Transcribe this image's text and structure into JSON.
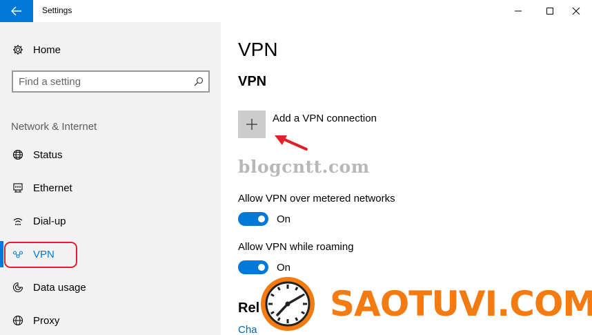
{
  "window": {
    "title": "Settings",
    "back_icon": "arrow-left-icon",
    "accent": "#0078d7"
  },
  "sidebar": {
    "home_label": "Home",
    "search_placeholder": "Find a setting",
    "section_label": "Network & Internet",
    "items": [
      {
        "label": "Status",
        "icon": "globe-icon"
      },
      {
        "label": "Ethernet",
        "icon": "ethernet-icon"
      },
      {
        "label": "Dial-up",
        "icon": "dialup-icon"
      },
      {
        "label": "VPN",
        "icon": "vpn-icon"
      },
      {
        "label": "Data usage",
        "icon": "data-usage-icon"
      },
      {
        "label": "Proxy",
        "icon": "proxy-icon"
      }
    ],
    "active_item": "VPN"
  },
  "main": {
    "page_title": "VPN",
    "section_title": "VPN",
    "add_vpn_label": "Add a VPN connection",
    "watermark": "blogcntt.com",
    "metered_label": "Allow VPN over metered networks",
    "metered_state": "On",
    "roaming_label": "Allow VPN while roaming",
    "roaming_state": "On",
    "related_heading": "Rel",
    "related_link": "Cha"
  },
  "overlay": {
    "logo_text": "SAOTUVI.COM",
    "logo_color": "#f37b12",
    "highlight_color": "#e0202b"
  }
}
